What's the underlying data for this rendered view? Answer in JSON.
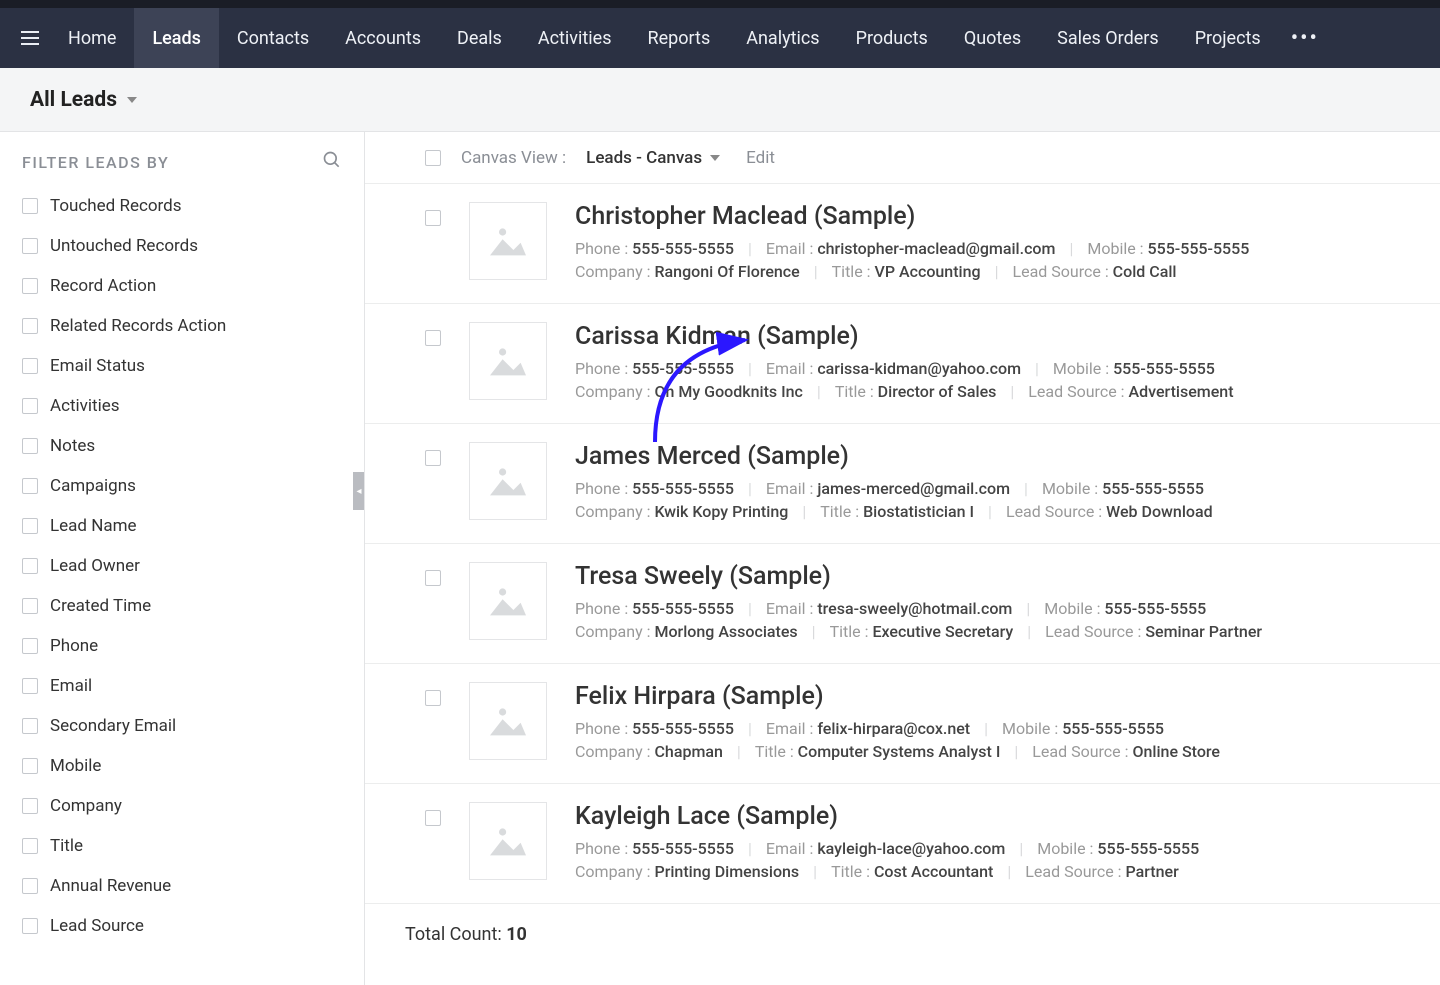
{
  "topnav": {
    "items": [
      "Home",
      "Leads",
      "Contacts",
      "Accounts",
      "Deals",
      "Activities",
      "Reports",
      "Analytics",
      "Products",
      "Quotes",
      "Sales Orders",
      "Projects"
    ],
    "active_index": 1
  },
  "subheader": {
    "view_label": "All Leads"
  },
  "filter": {
    "title": "FILTER LEADS BY",
    "items": [
      "Touched Records",
      "Untouched Records",
      "Record Action",
      "Related Records Action",
      "Email Status",
      "Activities",
      "Notes",
      "Campaigns",
      "Lead Name",
      "Lead Owner",
      "Created Time",
      "Phone",
      "Email",
      "Secondary Email",
      "Mobile",
      "Company",
      "Title",
      "Annual Revenue",
      "Lead Source"
    ]
  },
  "list_header": {
    "canvas_label": "Canvas View :",
    "canvas_value": "Leads - Canvas",
    "edit_label": "Edit"
  },
  "field_labels": {
    "phone": "Phone :",
    "email": "Email :",
    "mobile": "Mobile :",
    "company": "Company :",
    "title": "Title :",
    "lead_source": "Lead Source :"
  },
  "leads": [
    {
      "name": "Christopher Maclead (Sample)",
      "phone": "555-555-5555",
      "email": "christopher-maclead@gmail.com",
      "mobile": "555-555-5555",
      "company": "Rangoni Of Florence",
      "title": "VP Accounting",
      "lead_source": "Cold Call"
    },
    {
      "name": "Carissa Kidman (Sample)",
      "phone": "555-555-5555",
      "email": "carissa-kidman@yahoo.com",
      "mobile": "555-555-5555",
      "company": "Oh My Goodknits Inc",
      "title": "Director of Sales",
      "lead_source": "Advertisement"
    },
    {
      "name": "James Merced (Sample)",
      "phone": "555-555-5555",
      "email": "james-merced@gmail.com",
      "mobile": "555-555-5555",
      "company": "Kwik Kopy Printing",
      "title": "Biostatistician I",
      "lead_source": "Web Download"
    },
    {
      "name": "Tresa Sweely (Sample)",
      "phone": "555-555-5555",
      "email": "tresa-sweely@hotmail.com",
      "mobile": "555-555-5555",
      "company": "Morlong Associates",
      "title": "Executive Secretary",
      "lead_source": "Seminar Partner"
    },
    {
      "name": "Felix Hirpara (Sample)",
      "phone": "555-555-5555",
      "email": "felix-hirpara@cox.net",
      "mobile": "555-555-5555",
      "company": "Chapman",
      "title": "Computer Systems Analyst I",
      "lead_source": "Online Store"
    },
    {
      "name": "Kayleigh Lace (Sample)",
      "phone": "555-555-5555",
      "email": "kayleigh-lace@yahoo.com",
      "mobile": "555-555-5555",
      "company": "Printing Dimensions",
      "title": "Cost Accountant",
      "lead_source": "Partner"
    }
  ],
  "footer": {
    "label": "Total Count:",
    "value": "10"
  }
}
